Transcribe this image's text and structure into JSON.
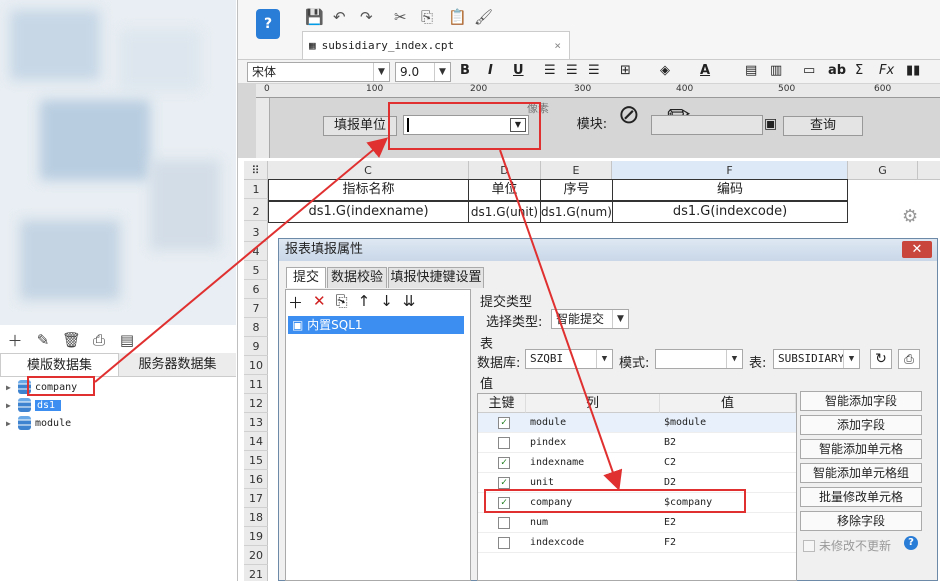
{
  "left": {
    "tab_template": "模版数据集",
    "tab_server": "服务器数据集",
    "tree": [
      "company",
      "ds1",
      "module"
    ]
  },
  "file_tab": "subsidiary_index.cpt",
  "format": {
    "font": "宋体",
    "size": "9.0",
    "bold": "B",
    "italic": "I",
    "underline": "U"
  },
  "ruler": [
    "0",
    "100",
    "200",
    "300",
    "400",
    "500",
    "600"
  ],
  "ruler_hint": "像素",
  "param": {
    "label1": "填报单位",
    "label2": "模块:",
    "query": "查询"
  },
  "grid": {
    "cols": [
      "C",
      "D",
      "E",
      "F",
      "G"
    ],
    "rows": [
      "1",
      "2",
      "3",
      "4",
      "5",
      "6",
      "7",
      "8",
      "9",
      "10",
      "11",
      "12",
      "13",
      "14",
      "15",
      "16",
      "17",
      "18",
      "19",
      "20",
      "21"
    ],
    "row1": [
      "指标名称",
      "单位",
      "序号",
      "编码"
    ],
    "row2": [
      "ds1.G(indexname)",
      "ds1.G(unit)",
      "ds1.G(num)",
      "ds1.G(indexcode)"
    ]
  },
  "dialog": {
    "title": "报表填报属性",
    "tabs": [
      "提交",
      "数据校验",
      "填报快捷键设置"
    ],
    "sql_item": "内置SQL1",
    "submit_type_header": "提交类型",
    "select_type_label": "选择类型:",
    "select_type_value": "智能提交",
    "table_header": "表",
    "db_label": "数据库:",
    "db_value": "SZQBI",
    "schema_label": "模式:",
    "schema_value": "",
    "table_label": "表:",
    "table_value": "SUBSIDIARY",
    "value_header": "值",
    "columns": [
      "主键",
      "列",
      "值"
    ],
    "rows": [
      {
        "checked": true,
        "col": "module",
        "val": "$module"
      },
      {
        "checked": false,
        "col": "pindex",
        "val": "B2"
      },
      {
        "checked": true,
        "col": "indexname",
        "val": "C2"
      },
      {
        "checked": true,
        "col": "unit",
        "val": "D2"
      },
      {
        "checked": true,
        "col": "company",
        "val": "$company"
      },
      {
        "checked": false,
        "col": "num",
        "val": "E2"
      },
      {
        "checked": false,
        "col": "indexcode",
        "val": "F2"
      }
    ],
    "side_buttons": [
      "智能添加字段",
      "添加字段",
      "智能添加单元格",
      "智能添加单元格组",
      "批量修改单元格",
      "移除字段"
    ],
    "no_update": "未修改不更新",
    "check": "✓"
  },
  "colors": {
    "highlight": "#e03030",
    "selection": "#3c8ff0"
  }
}
